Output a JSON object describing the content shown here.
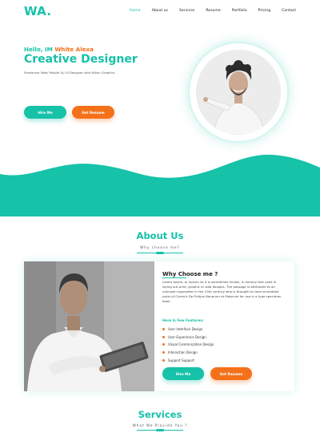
{
  "brand": {
    "logo": "WA.",
    "accent": "#16c2a8",
    "accent_orange": "#f4711a"
  },
  "nav": {
    "items": [
      "Home",
      "About us",
      "Services",
      "Resume",
      "Portfolio",
      "Pricing",
      "Contact"
    ],
    "active": "Home"
  },
  "hero": {
    "hello_prefix": "Hello, IM ",
    "hello_name": "White Alexa",
    "title": "Creative Designer",
    "subtitle": "Freelancer Web/ Mobile UI/ UI Designer with Hilton Graphics",
    "hire_button": "Hire Me",
    "resume_button": "Get Resume"
  },
  "about": {
    "title": "About Us",
    "subtitle": "Why choose me?",
    "why_title": "Why Choose me ?",
    "why_text": "Lorem Ipsum, or lipsum as it is sometimes known, is dummy text used in laying out print, graphic or web designs. The passage is attributed to an unknown typesetter in the 15th century who is thought to have scrambled parts of Cicero's De Finibus Bonorum et Malorum for use in a type specimen book.",
    "features_title": "Here Is Few Features:",
    "features": [
      "User Interface Design",
      "User Experience Design",
      "Visual Commnication Design",
      "Interaction Design",
      "Support Support"
    ],
    "hire_button": "Hire Me",
    "resume_button": "Get Resume"
  },
  "services": {
    "title": "Services",
    "subtitle": "What We Provide You ?"
  }
}
